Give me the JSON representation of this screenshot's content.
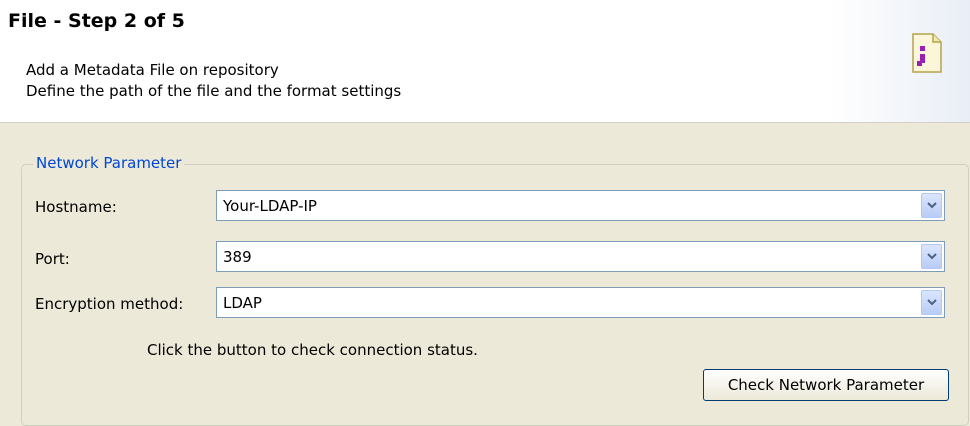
{
  "header": {
    "title": "File - Step 2 of 5",
    "description_line1": "Add a Metadata File on repository",
    "description_line2": "Define the path of the file and the format settings",
    "icon": "file-icon"
  },
  "network_group": {
    "legend": "Network Parameter",
    "fields": [
      {
        "label": "Hostname:",
        "value": "Your-LDAP-IP"
      },
      {
        "label": "Port:",
        "value": "389"
      },
      {
        "label": "Encryption method:",
        "value": "LDAP"
      }
    ],
    "hint": "Click the button to check connection status.",
    "check_button_label": "Check Network Parameter"
  },
  "colors": {
    "accent": "#0046d5",
    "window_bg": "#ece9d8",
    "icon_purple": "#9b1fb3"
  }
}
